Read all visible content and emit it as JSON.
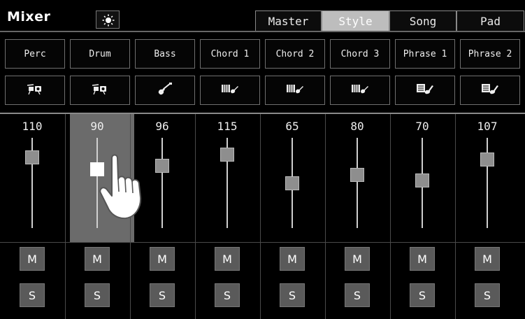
{
  "header": {
    "title": "Mixer"
  },
  "tabs": [
    {
      "label": "Master",
      "active": false
    },
    {
      "label": "Style",
      "active": true
    },
    {
      "label": "Song",
      "active": false
    },
    {
      "label": "Pad",
      "active": false
    }
  ],
  "channels": [
    {
      "name": "Perc",
      "icon": "drum-kit-icon",
      "value": "110",
      "mute_label": "M",
      "solo_label": "S",
      "level": 110,
      "selected": false
    },
    {
      "name": "Drum",
      "icon": "drum-kit-icon",
      "value": "90",
      "mute_label": "M",
      "solo_label": "S",
      "level": 90,
      "selected": true
    },
    {
      "name": "Bass",
      "icon": "bass-guitar-icon",
      "value": "96",
      "mute_label": "M",
      "solo_label": "S",
      "level": 96,
      "selected": false
    },
    {
      "name": "Chord 1",
      "icon": "keyboard-guitar-icon",
      "value": "115",
      "mute_label": "M",
      "solo_label": "S",
      "level": 115,
      "selected": false
    },
    {
      "name": "Chord 2",
      "icon": "keyboard-guitar-icon",
      "value": "65",
      "mute_label": "M",
      "solo_label": "S",
      "level": 65,
      "selected": false
    },
    {
      "name": "Chord 3",
      "icon": "keyboard-guitar-icon",
      "value": "80",
      "mute_label": "M",
      "solo_label": "S",
      "level": 80,
      "selected": false
    },
    {
      "name": "Phrase 1",
      "icon": "sheet-guitar-icon",
      "value": "70",
      "mute_label": "M",
      "solo_label": "S",
      "level": 70,
      "selected": false
    },
    {
      "name": "Phrase 2",
      "icon": "sheet-guitar-icon",
      "value": "107",
      "mute_label": "M",
      "solo_label": "S",
      "level": 107,
      "selected": false
    }
  ]
}
